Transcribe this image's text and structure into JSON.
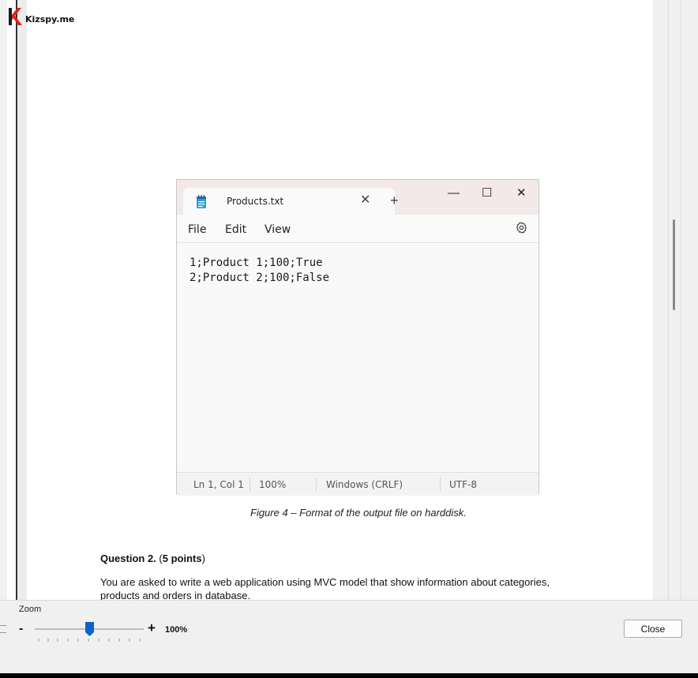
{
  "logo": {
    "text": "Kizspy.me",
    "mark_color": "#e0201b"
  },
  "notepad": {
    "tab_title": "Products.txt",
    "menu": [
      "File",
      "Edit",
      "View"
    ],
    "content_lines": [
      "1;Product 1;100;True",
      "2;Product 2;100;False"
    ],
    "status": {
      "position": "Ln 1, Col 1",
      "zoom": "100%",
      "line_ending": "Windows (CRLF)",
      "encoding": "UTF-8"
    }
  },
  "caption": "Figure 4 – Format of the output file on harddisk.",
  "question": {
    "label": "Question 2.",
    "open_paren": " (",
    "points": "5 points",
    "close_paren": ")",
    "body": "You are asked to write a    web  application  using MVC model that    show information about   categories, products and orders in database."
  },
  "toolbar": {
    "zoom_label": "Zoom",
    "zoom_minus": "-",
    "zoom_plus": "+",
    "zoom_value": "100%",
    "zoom_level_percent": 100,
    "close_label": "Close"
  },
  "colors": {
    "accent": "#0a64c8",
    "notepad_titlebar": "#f3e9e9"
  }
}
